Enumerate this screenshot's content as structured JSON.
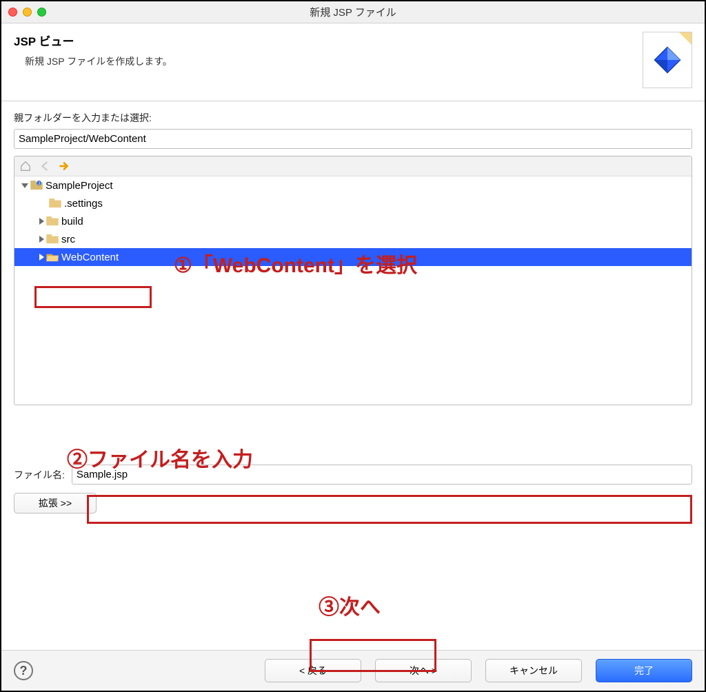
{
  "window": {
    "title": "新規 JSP ファイル"
  },
  "header": {
    "title": "JSP ビュー",
    "subtitle": "新規 JSP ファイルを作成します。"
  },
  "parentFolder": {
    "label": "親フォルダーを入力または選択:",
    "value": "SampleProject/WebContent"
  },
  "tree": {
    "rootName": "SampleProject",
    "children": {
      "settings": ".settings",
      "build": "build",
      "src": "src",
      "webcontent": "WebContent"
    }
  },
  "annotations": {
    "step1": "①「WebContent」を選択",
    "step2": "②ファイル名を入力",
    "step3": "③次へ"
  },
  "filename": {
    "label": "ファイル名:",
    "value": "Sample.jsp"
  },
  "expand": {
    "label": "拡張 >>"
  },
  "footer": {
    "back": "< 戻る",
    "next": "次へ >",
    "cancel": "キャンセル",
    "finish": "完了"
  }
}
